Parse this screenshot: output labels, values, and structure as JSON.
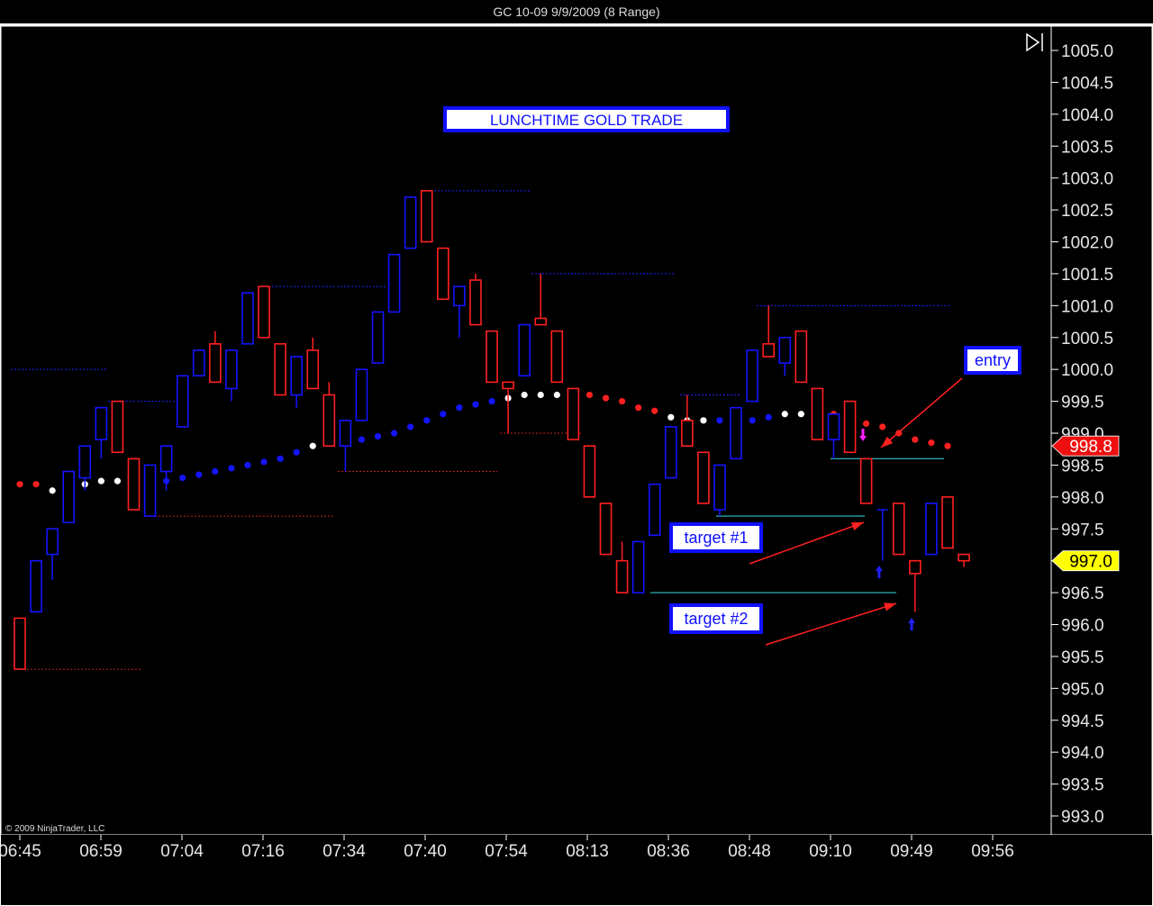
{
  "window": {
    "title": "GC 10-09  9/9/2009 (8 Range)"
  },
  "copyright": "© 2009 NinjaTrader, LLC",
  "colors": {
    "up": "#1414ff",
    "down": "#ff2020",
    "background": "#000000",
    "axis_text": "#e6e6e6"
  },
  "chart_data": {
    "type": "candlestick",
    "title": "LUNCHTIME GOLD TRADE",
    "ylim": [
      992.8,
      1005.3
    ],
    "yticks": [
      1005.0,
      1004.5,
      1004.0,
      1003.5,
      1003.0,
      1002.5,
      1002.0,
      1001.5,
      1001.0,
      1000.5,
      1000.0,
      999.5,
      999.0,
      998.5,
      998.0,
      997.5,
      997.0,
      996.5,
      996.0,
      995.5,
      995.0,
      994.5,
      994.0,
      993.5,
      993.0
    ],
    "ytick_labels": [
      "1005.0",
      "1004.5",
      "1004.0",
      "1003.5",
      "1003.0",
      "1002.5",
      "1002.0",
      "1001.5",
      "1001.0",
      "1000.5",
      "1000.0",
      "999.5",
      "999.0",
      "998.5",
      "998.0",
      "997.5",
      "997.0",
      "996.5",
      "996.0",
      "995.5",
      "995.0",
      "994.5",
      "994.0",
      "993.5",
      "993.0"
    ],
    "xtick_labels": [
      "06:45",
      "06:59",
      "07:04",
      "07:16",
      "07:34",
      "07:40",
      "07:54",
      "08:13",
      "08:36",
      "08:48",
      "09:10",
      "09:49",
      "09:56"
    ],
    "candles": [
      {
        "o": 996.1,
        "h": 996.1,
        "l": 995.3,
        "c": 995.3
      },
      {
        "o": 996.2,
        "h": 997.0,
        "l": 996.2,
        "c": 997.0
      },
      {
        "o": 997.1,
        "h": 997.5,
        "l": 996.7,
        "c": 997.5
      },
      {
        "o": 997.6,
        "h": 998.4,
        "l": 997.6,
        "c": 998.4
      },
      {
        "o": 998.3,
        "h": 998.8,
        "l": 998.1,
        "c": 998.8
      },
      {
        "o": 998.9,
        "h": 999.4,
        "l": 998.6,
        "c": 999.4
      },
      {
        "o": 999.5,
        "h": 999.5,
        "l": 998.7,
        "c": 998.7
      },
      {
        "o": 998.6,
        "h": 998.6,
        "l": 997.8,
        "c": 997.8
      },
      {
        "o": 997.7,
        "h": 998.5,
        "l": 997.7,
        "c": 998.5
      },
      {
        "o": 998.4,
        "h": 998.8,
        "l": 998.1,
        "c": 998.8
      },
      {
        "o": 999.1,
        "h": 999.9,
        "l": 999.1,
        "c": 999.9
      },
      {
        "o": 999.9,
        "h": 1000.3,
        "l": 999.9,
        "c": 1000.3
      },
      {
        "o": 1000.4,
        "h": 1000.6,
        "l": 999.8,
        "c": 999.8
      },
      {
        "o": 999.7,
        "h": 1000.3,
        "l": 999.5,
        "c": 1000.3
      },
      {
        "o": 1000.4,
        "h": 1001.2,
        "l": 1000.4,
        "c": 1001.2
      },
      {
        "o": 1001.3,
        "h": 1001.3,
        "l": 1000.5,
        "c": 1000.5
      },
      {
        "o": 1000.4,
        "h": 1000.4,
        "l": 999.6,
        "c": 999.6
      },
      {
        "o": 999.6,
        "h": 1000.2,
        "l": 999.4,
        "c": 1000.2
      },
      {
        "o": 1000.3,
        "h": 1000.5,
        "l": 999.7,
        "c": 999.7
      },
      {
        "o": 999.6,
        "h": 999.8,
        "l": 998.8,
        "c": 998.8
      },
      {
        "o": 998.8,
        "h": 999.2,
        "l": 998.4,
        "c": 999.2
      },
      {
        "o": 999.2,
        "h": 1000.0,
        "l": 999.2,
        "c": 1000.0
      },
      {
        "o": 1000.1,
        "h": 1000.9,
        "l": 1000.1,
        "c": 1000.9
      },
      {
        "o": 1000.9,
        "h": 1001.8,
        "l": 1000.9,
        "c": 1001.8
      },
      {
        "o": 1001.9,
        "h": 1002.7,
        "l": 1001.9,
        "c": 1002.7
      },
      {
        "o": 1002.8,
        "h": 1002.8,
        "l": 1002.0,
        "c": 1002.0
      },
      {
        "o": 1001.9,
        "h": 1001.9,
        "l": 1001.1,
        "c": 1001.1
      },
      {
        "o": 1001.0,
        "h": 1001.3,
        "l": 1000.5,
        "c": 1001.3
      },
      {
        "o": 1001.4,
        "h": 1001.5,
        "l": 1000.7,
        "c": 1000.7
      },
      {
        "o": 1000.6,
        "h": 1000.6,
        "l": 999.8,
        "c": 999.8
      },
      {
        "o": 999.8,
        "h": 999.8,
        "l": 999.0,
        "c": 999.7
      },
      {
        "o": 999.9,
        "h": 1000.7,
        "l": 999.9,
        "c": 1000.7
      },
      {
        "o": 1000.8,
        "h": 1001.5,
        "l": 1000.7,
        "c": 1000.7
      },
      {
        "o": 1000.6,
        "h": 1000.6,
        "l": 999.8,
        "c": 999.8
      },
      {
        "o": 999.7,
        "h": 999.7,
        "l": 998.9,
        "c": 998.9
      },
      {
        "o": 998.8,
        "h": 998.8,
        "l": 998.0,
        "c": 998.0
      },
      {
        "o": 997.9,
        "h": 997.9,
        "l": 997.1,
        "c": 997.1
      },
      {
        "o": 997.0,
        "h": 997.3,
        "l": 996.5,
        "c": 996.5
      },
      {
        "o": 996.5,
        "h": 997.3,
        "l": 996.5,
        "c": 997.3
      },
      {
        "o": 997.4,
        "h": 998.2,
        "l": 997.4,
        "c": 998.2
      },
      {
        "o": 998.3,
        "h": 999.1,
        "l": 998.3,
        "c": 999.1
      },
      {
        "o": 999.2,
        "h": 999.6,
        "l": 998.8,
        "c": 998.8
      },
      {
        "o": 998.7,
        "h": 998.7,
        "l": 997.9,
        "c": 997.9
      },
      {
        "o": 997.8,
        "h": 998.5,
        "l": 997.7,
        "c": 998.5
      },
      {
        "o": 998.6,
        "h": 999.4,
        "l": 998.6,
        "c": 999.4
      },
      {
        "o": 999.5,
        "h": 1000.3,
        "l": 999.5,
        "c": 1000.3
      },
      {
        "o": 1000.4,
        "h": 1001.0,
        "l": 1000.2,
        "c": 1000.2
      },
      {
        "o": 1000.1,
        "h": 1000.5,
        "l": 999.9,
        "c": 1000.5
      },
      {
        "o": 1000.6,
        "h": 1000.6,
        "l": 999.8,
        "c": 999.8
      },
      {
        "o": 999.7,
        "h": 999.7,
        "l": 998.9,
        "c": 998.9
      },
      {
        "o": 998.9,
        "h": 999.3,
        "l": 998.6,
        "c": 999.3
      },
      {
        "o": 999.5,
        "h": 999.5,
        "l": 998.7,
        "c": 998.7
      },
      {
        "o": 998.6,
        "h": 998.6,
        "l": 997.9,
        "c": 997.9
      },
      {
        "o": 997.8,
        "h": 997.8,
        "l": 997.0,
        "c": 997.8
      },
      {
        "o": 997.9,
        "h": 997.9,
        "l": 997.1,
        "c": 997.1
      },
      {
        "o": 997.0,
        "h": 997.0,
        "l": 996.2,
        "c": 996.8
      },
      {
        "o": 997.1,
        "h": 997.9,
        "l": 997.1,
        "c": 997.9
      },
      {
        "o": 998.0,
        "h": 998.0,
        "l": 997.2,
        "c": 997.2
      },
      {
        "o": 997.1,
        "h": 997.1,
        "l": 996.9,
        "c": 997.0
      }
    ],
    "moving_average": [
      998.2,
      998.2,
      998.1,
      998.15,
      998.2,
      998.25,
      998.25,
      998.25,
      998.25,
      998.25,
      998.3,
      998.35,
      998.4,
      998.45,
      998.5,
      998.55,
      998.6,
      998.7,
      998.8,
      998.85,
      998.85,
      998.9,
      998.95,
      999.0,
      999.1,
      999.2,
      999.3,
      999.4,
      999.45,
      999.5,
      999.55,
      999.6,
      999.6,
      999.6,
      999.6,
      999.6,
      999.55,
      999.5,
      999.4,
      999.35,
      999.25,
      999.2,
      999.2,
      999.2,
      999.2,
      999.2,
      999.25,
      999.3,
      999.3,
      999.3,
      999.3,
      999.2,
      999.15,
      999.1,
      999.0,
      998.9,
      998.85,
      998.8
    ],
    "ma_trend": [
      "down",
      "down",
      "flat",
      "flat",
      "flat",
      "flat",
      "flat",
      "flat",
      "flat",
      "up",
      "up",
      "up",
      "up",
      "up",
      "up",
      "up",
      "up",
      "up",
      "flat",
      "flat",
      "flat",
      "up",
      "up",
      "up",
      "up",
      "up",
      "up",
      "up",
      "up",
      "up",
      "flat",
      "flat",
      "flat",
      "flat",
      "down",
      "down",
      "down",
      "down",
      "down",
      "down",
      "flat",
      "flat",
      "flat",
      "up",
      "up",
      "up",
      "up",
      "flat",
      "flat",
      "flat",
      "down",
      "down",
      "down",
      "down",
      "down",
      "down",
      "down",
      "down"
    ],
    "price_markers": [
      {
        "label": "998.8",
        "value": 998.8,
        "kind": "last-red"
      },
      {
        "label": "997.0",
        "value": 997.0,
        "kind": "current-yellow"
      }
    ],
    "annotations": [
      {
        "name": "entry",
        "text": "entry"
      },
      {
        "name": "target-1",
        "text": "target #1"
      },
      {
        "name": "target-2",
        "text": "target #2"
      }
    ]
  }
}
